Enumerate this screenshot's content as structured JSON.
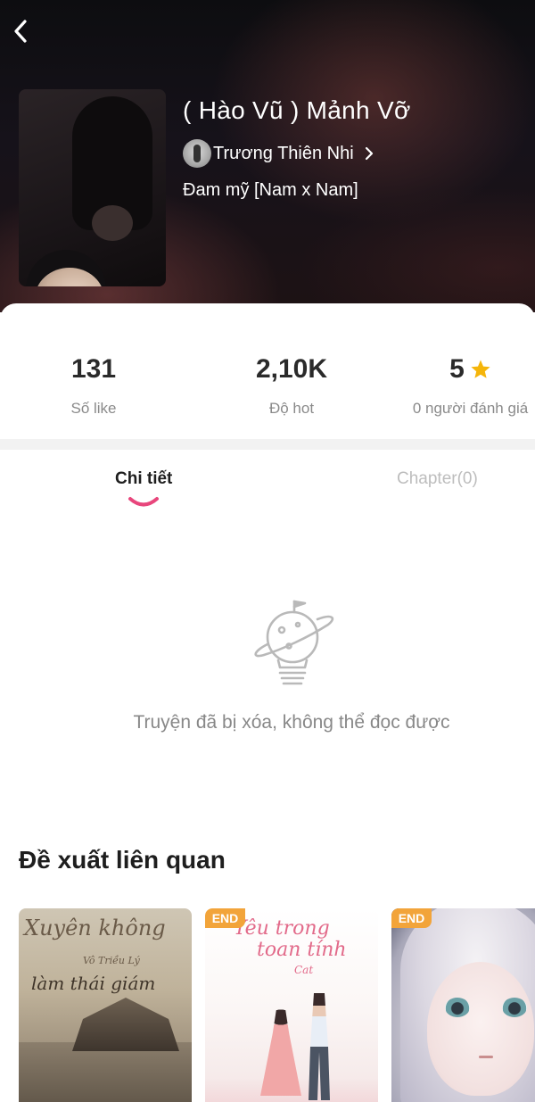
{
  "header": {
    "title": "( Hào Vũ ) Mảnh Vỡ",
    "author": "Trương Thiên Nhi",
    "genre": "Đam mỹ [Nam x Nam]"
  },
  "stats": {
    "likes": {
      "value": "131",
      "label": "Số like"
    },
    "hot": {
      "value": "2,10K",
      "label": "Độ hot"
    },
    "rating": {
      "value": "5",
      "label": "0 người đánh giá"
    }
  },
  "tabs": [
    {
      "label": "Chi tiết",
      "active": true
    },
    {
      "label": "Chapter(0)",
      "active": false
    }
  ],
  "empty_state": {
    "icon": "planet-lightbulb-icon",
    "message": "Truyện đã bị xóa, không thể đọc được"
  },
  "related": {
    "title": "Đề xuất liên quan",
    "items": [
      {
        "badge": "",
        "cover_title": "Xuyên không",
        "cover_author": "Vô Triều Lý",
        "cover_subtitle": "làm thái giám"
      },
      {
        "badge": "END",
        "cover_title": "Yêu trong",
        "cover_subtitle": "toan tính",
        "cover_small": "Cat"
      },
      {
        "badge": "END"
      }
    ]
  },
  "colors": {
    "accent_pink": "#e8467c",
    "star": "#f5b50a",
    "badge_orange": "#f2a43a"
  }
}
